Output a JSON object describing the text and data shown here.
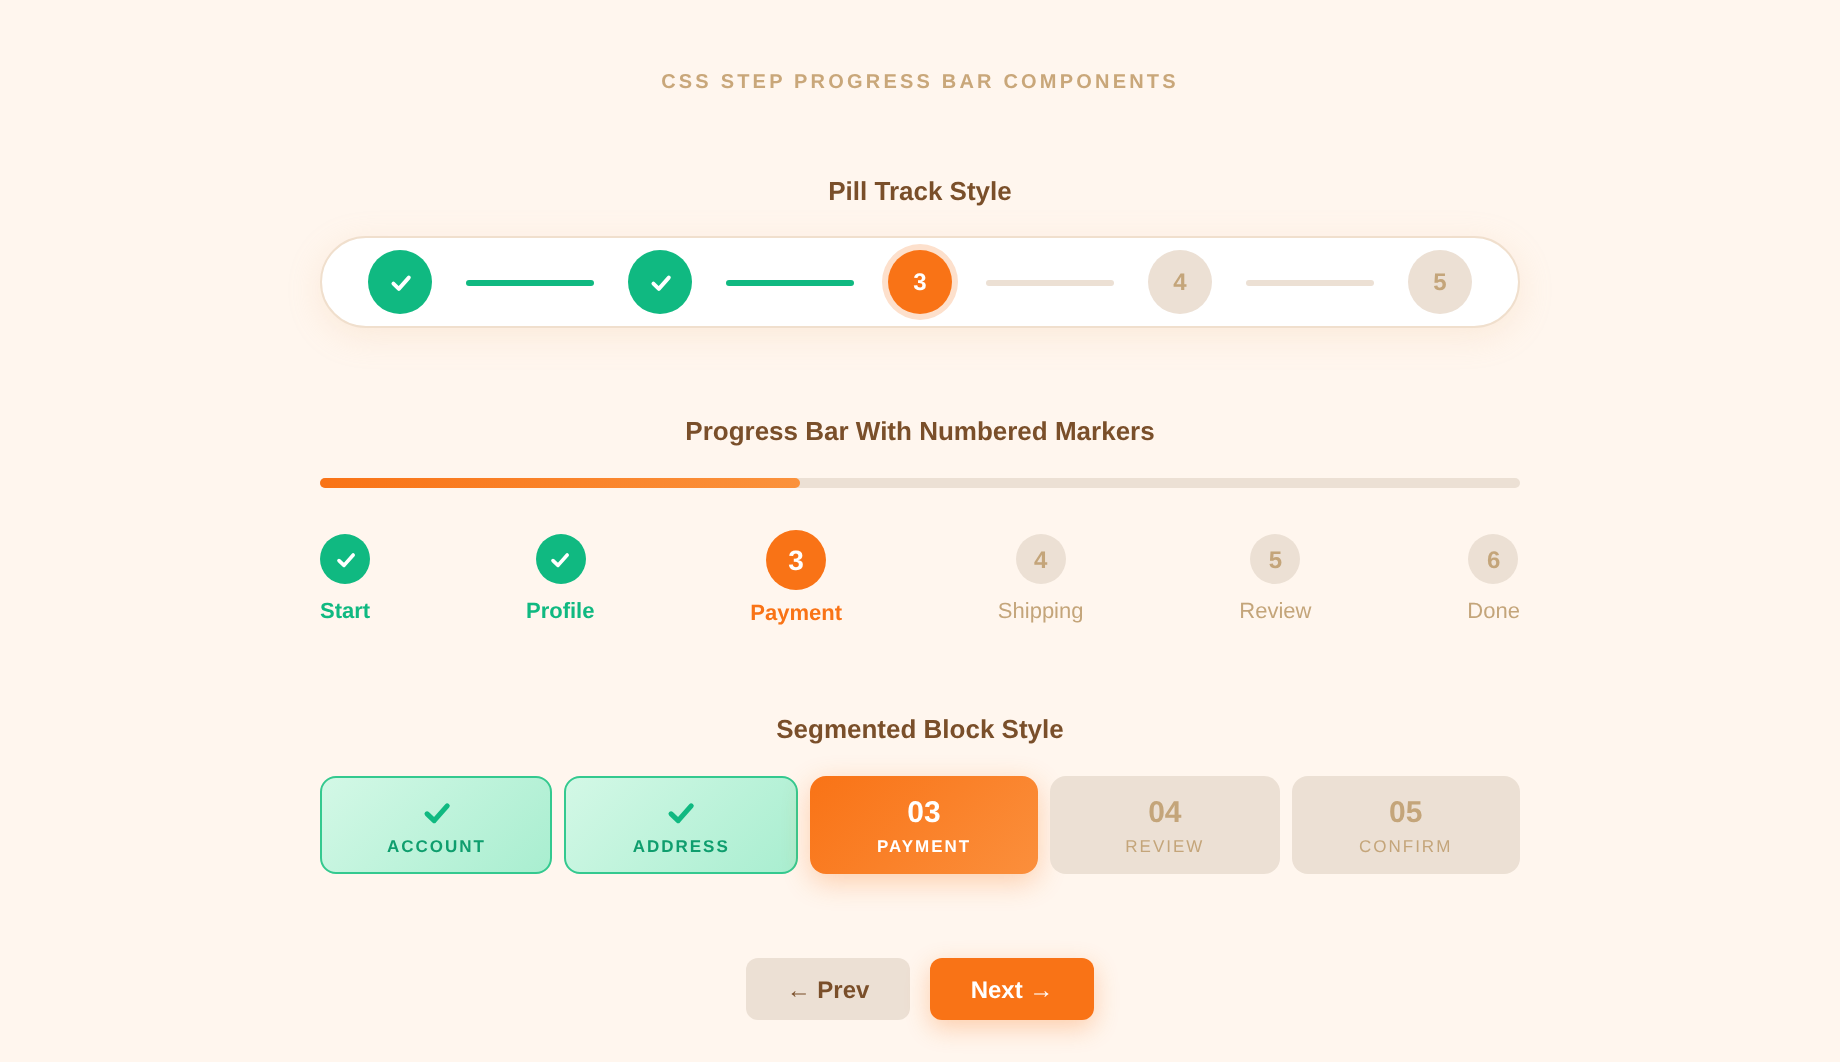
{
  "page_title": "CSS STEP PROGRESS BAR COMPONENTS",
  "pill_track": {
    "heading": "Pill Track Style",
    "steps": [
      {
        "kind": "done"
      },
      {
        "kind": "done"
      },
      {
        "kind": "current",
        "number": "3"
      },
      {
        "kind": "upcoming",
        "number": "4"
      },
      {
        "kind": "upcoming",
        "number": "5"
      }
    ]
  },
  "marker_bar": {
    "heading": "Progress Bar With Numbered Markers",
    "level": 0.4,
    "steps": [
      {
        "kind": "done",
        "label": "Start"
      },
      {
        "kind": "done",
        "label": "Profile"
      },
      {
        "kind": "current",
        "number": "3",
        "label": "Payment"
      },
      {
        "kind": "upcoming",
        "number": "4",
        "label": "Shipping"
      },
      {
        "kind": "upcoming",
        "number": "5",
        "label": "Review"
      },
      {
        "kind": "upcoming",
        "number": "6",
        "label": "Done"
      }
    ]
  },
  "segmented": {
    "heading": "Segmented Block Style",
    "blocks": [
      {
        "kind": "done",
        "label": "ACCOUNT"
      },
      {
        "kind": "done",
        "label": "ADDRESS"
      },
      {
        "kind": "current",
        "number": "03",
        "label": "PAYMENT"
      },
      {
        "kind": "upcoming",
        "number": "04",
        "label": "REVIEW"
      },
      {
        "kind": "upcoming",
        "number": "05",
        "label": "CONFIRM"
      }
    ]
  },
  "buttons": [
    {
      "kind": "secondary",
      "label": "← Prev"
    },
    {
      "kind": "primary",
      "label": "Next →"
    }
  ]
}
